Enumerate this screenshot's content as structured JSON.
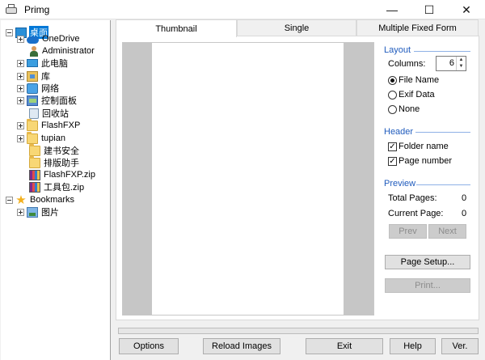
{
  "window": {
    "title": "Primg",
    "minimize": "—",
    "maximize": "☐",
    "close": "✕"
  },
  "tree": [
    {
      "label": "桌面",
      "icon": "desktop-icon",
      "selected": true
    },
    {
      "label": "OneDrive",
      "icon": "cloud-icon"
    },
    {
      "label": "Administrator",
      "icon": "user-icon"
    },
    {
      "label": "此电脑",
      "icon": "computer-icon"
    },
    {
      "label": "库",
      "icon": "library-icon"
    },
    {
      "label": "网络",
      "icon": "network-icon"
    },
    {
      "label": "控制面板",
      "icon": "control-panel-icon"
    },
    {
      "label": "回收站",
      "icon": "recycle-bin-icon"
    },
    {
      "label": "FlashFXP",
      "icon": "folder-icon"
    },
    {
      "label": "tupian",
      "icon": "folder-icon"
    },
    {
      "label": "建书安全",
      "icon": "folder-icon"
    },
    {
      "label": "排版助手",
      "icon": "folder-icon"
    },
    {
      "label": "FlashFXP.zip",
      "icon": "zip-icon"
    },
    {
      "label": "工具包.zip",
      "icon": "zip-icon"
    },
    {
      "label": "Bookmarks",
      "icon": "star-icon"
    },
    {
      "label": "图片",
      "icon": "picture-icon"
    }
  ],
  "tabs": [
    "Thumbnail",
    "Single",
    "Multiple Fixed Form"
  ],
  "active_tab": "Thumbnail",
  "layout": {
    "heading": "Layout",
    "columns_label": "Columns:",
    "columns_value": "6",
    "options": [
      "File Name",
      "Exif Data",
      "None"
    ],
    "selected": "File Name"
  },
  "header": {
    "heading": "Header",
    "folder_name": "Folder name",
    "folder_name_checked": true,
    "page_number": "Page number",
    "page_number_checked": true
  },
  "preview": {
    "heading": "Preview",
    "total_pages_label": "Total Pages:",
    "total_pages": "0",
    "current_page_label": "Current Page:",
    "current_page": "0",
    "prev": "Prev",
    "next": "Next"
  },
  "actions": {
    "page_setup": "Page Setup...",
    "print": "Print..."
  },
  "bottom": {
    "options": "Options",
    "reload": "Reload Images",
    "exit": "Exit",
    "help": "Help",
    "version": "Ver."
  },
  "colors": {
    "accent": "#0078d7",
    "section": "#1f5bbd"
  }
}
